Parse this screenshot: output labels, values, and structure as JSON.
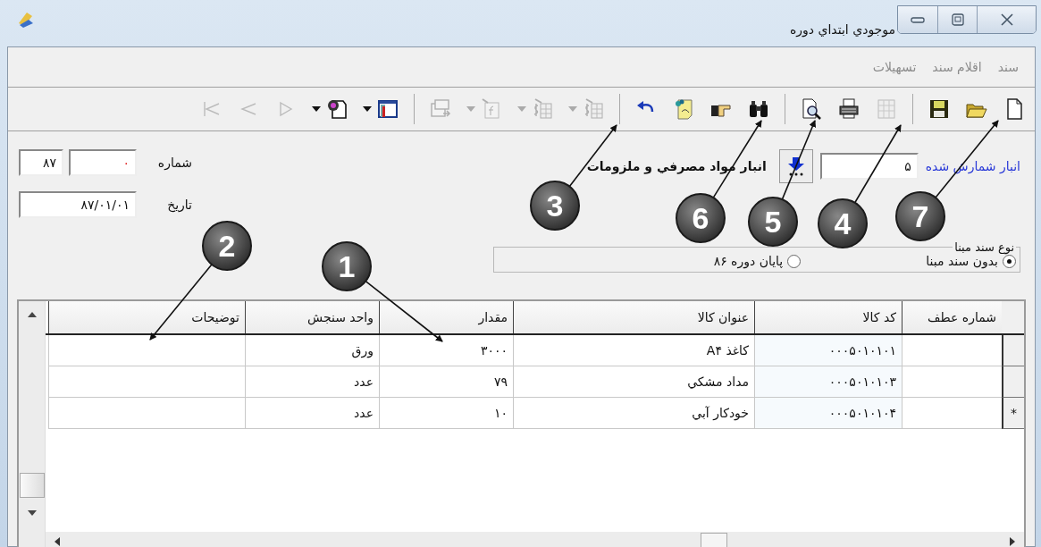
{
  "window": {
    "title": "موجودي ابتداي دوره"
  },
  "menu": [
    "سند",
    "اقلام سند",
    "تسهيلات"
  ],
  "toolbar": {
    "groups": [
      {
        "tools": [
          {
            "kind": "new",
            "disabled": false,
            "dropdown": false
          },
          {
            "kind": "open",
            "disabled": false,
            "dropdown": false
          },
          {
            "kind": "save",
            "disabled": false,
            "dropdown": false
          }
        ]
      },
      {
        "tools": [
          {
            "kind": "grid",
            "disabled": true,
            "dropdown": false
          },
          {
            "kind": "print",
            "disabled": false,
            "dropdown": false
          },
          {
            "kind": "preview",
            "disabled": false,
            "dropdown": false
          }
        ]
      },
      {
        "tools": [
          {
            "kind": "find",
            "disabled": false,
            "dropdown": false
          },
          {
            "kind": "hand",
            "disabled": false,
            "dropdown": false
          },
          {
            "kind": "note",
            "disabled": false,
            "dropdown": false
          },
          {
            "kind": "undo",
            "disabled": false,
            "dropdown": false
          }
        ]
      },
      {
        "tools": [
          {
            "kind": "dollar",
            "disabled": true,
            "dropdown": true
          },
          {
            "kind": "dollar",
            "disabled": true,
            "dropdown": true
          },
          {
            "kind": "func",
            "disabled": true,
            "dropdown": true
          },
          {
            "kind": "export",
            "disabled": true,
            "dropdown": false
          }
        ]
      },
      {
        "tools": [
          {
            "kind": "columns",
            "disabled": false,
            "dropdown": true
          },
          {
            "kind": "image",
            "disabled": false,
            "dropdown": true
          },
          {
            "kind": "next",
            "disabled": true,
            "dropdown": false
          },
          {
            "kind": "prev",
            "disabled": true,
            "dropdown": false
          },
          {
            "kind": "first",
            "disabled": true,
            "dropdown": false
          }
        ]
      }
    ]
  },
  "form": {
    "warehouse_link": "انبار شمارش شده",
    "warehouse_code": "۵",
    "warehouse_name": "انبار مواد مصرفي و ملزومات",
    "number_label": "شماره",
    "number_value": "٠",
    "number_year": "۸۷",
    "date_label": "تاریخ",
    "date_value": "۸۷/۰۱/۰۱",
    "base_group": {
      "legend": "نوع سند مبنا",
      "options": [
        {
          "label": "بدون سند مبنا",
          "selected": true
        },
        {
          "label": "پایان دوره ۸۶",
          "selected": false
        }
      ]
    }
  },
  "table": {
    "columns": [
      "شماره عطف",
      "کد کالا",
      "عنوان کالا",
      "مقدار",
      "واحد سنجش",
      "توضیحات"
    ],
    "rows": [
      {
        "marker": "",
        "cells": [
          "",
          "۰۰۰۵۰۱۰۱۰۱",
          "کاغذ A۴",
          "۳۰۰۰",
          "ورق",
          ""
        ]
      },
      {
        "marker": "",
        "cells": [
          "",
          "۰۰۰۵۰۱۰۱۰۳",
          "مداد مشکي",
          "۷۹",
          "عدد",
          ""
        ]
      },
      {
        "marker": "*",
        "cells": [
          "",
          "۰۰۰۵۰۱۰۱۰۴",
          "خودکار آبي",
          "۱۰",
          "عدد",
          ""
        ]
      }
    ]
  },
  "callouts": [
    "7",
    "4",
    "5",
    "6",
    "3",
    "1",
    "2"
  ]
}
